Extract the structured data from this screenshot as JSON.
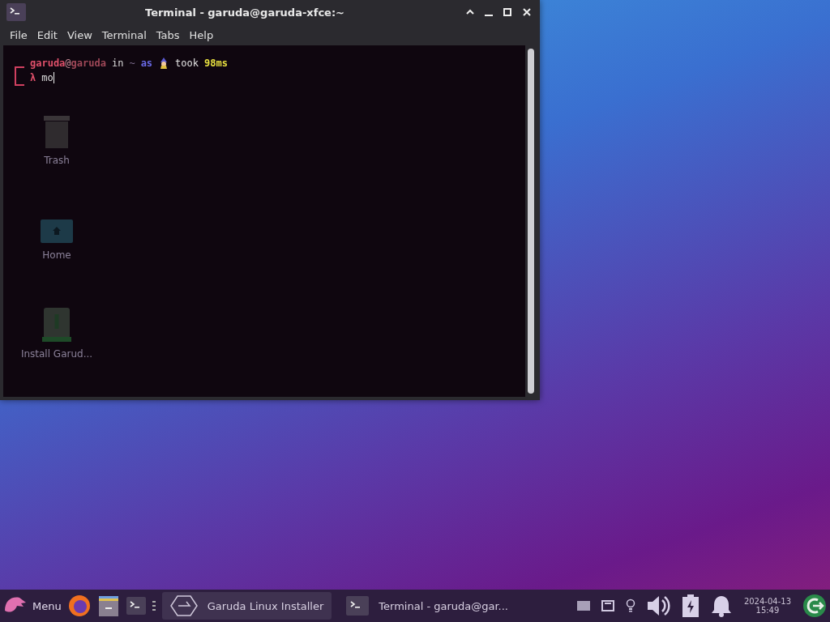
{
  "window": {
    "title": "Terminal - garuda@garuda-xfce:~",
    "menu": [
      "File",
      "Edit",
      "View",
      "Terminal",
      "Tabs",
      "Help"
    ]
  },
  "terminal": {
    "prompt": {
      "user": "garuda",
      "at": "@",
      "host": "garuda",
      "in": "in",
      "dir": "~",
      "as": "as",
      "took": "took",
      "duration": "98ms"
    },
    "input_line": {
      "symbol": "λ",
      "command": "mo"
    }
  },
  "desktop_icons": [
    {
      "label": "Trash",
      "kind": "trash"
    },
    {
      "label": "Home",
      "kind": "home"
    },
    {
      "label": "Install Garud...",
      "kind": "installer"
    }
  ],
  "taskbar": {
    "menu_label": "Menu",
    "tasks": [
      {
        "label": "Garuda Linux Installer",
        "selected": true,
        "kind": "installer"
      },
      {
        "label": "Terminal - garuda@gar...",
        "selected": false,
        "kind": "terminal"
      }
    ],
    "date": "2024-04-13",
    "time": "15:49"
  }
}
